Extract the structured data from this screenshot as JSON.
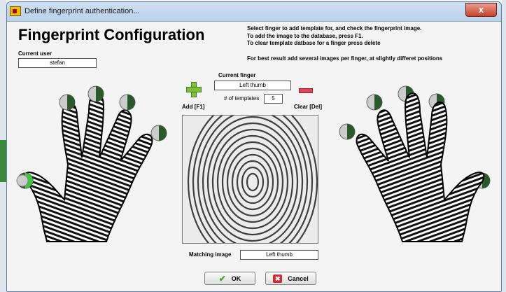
{
  "window": {
    "title": "Define fingerprint authentication...",
    "close_glyph": "x"
  },
  "heading": "Fingerprint Configuration",
  "instructions": [
    "Select finger to add template for, and check the fingerprint image.",
    "To add the image to the database, press F1.",
    "To clear template datbase for a finger press delete",
    "For best result add several images per finger, at slightly differet positions"
  ],
  "user": {
    "label": "Current user",
    "value": "stefan"
  },
  "finger": {
    "label": "Current finger",
    "value": "Left thumb",
    "templates_label": "# of templates",
    "templates_value": "5"
  },
  "add_button": {
    "label": "Add [F1]",
    "icon": "plus-icon"
  },
  "clear_button": {
    "label": "Clear [Del]",
    "icon": "minus-icon"
  },
  "matching": {
    "label": "Matching image",
    "value": "Left thumb"
  },
  "ok_button": {
    "label": "OK",
    "icon": "check-icon"
  },
  "cancel_button": {
    "label": "Cancel",
    "icon": "x-icon"
  },
  "colors": {
    "selected_finger": "#3cc83c",
    "add": "#7cc13a",
    "clear": "#e0455a",
    "titlebar": "#c4d8ee"
  }
}
